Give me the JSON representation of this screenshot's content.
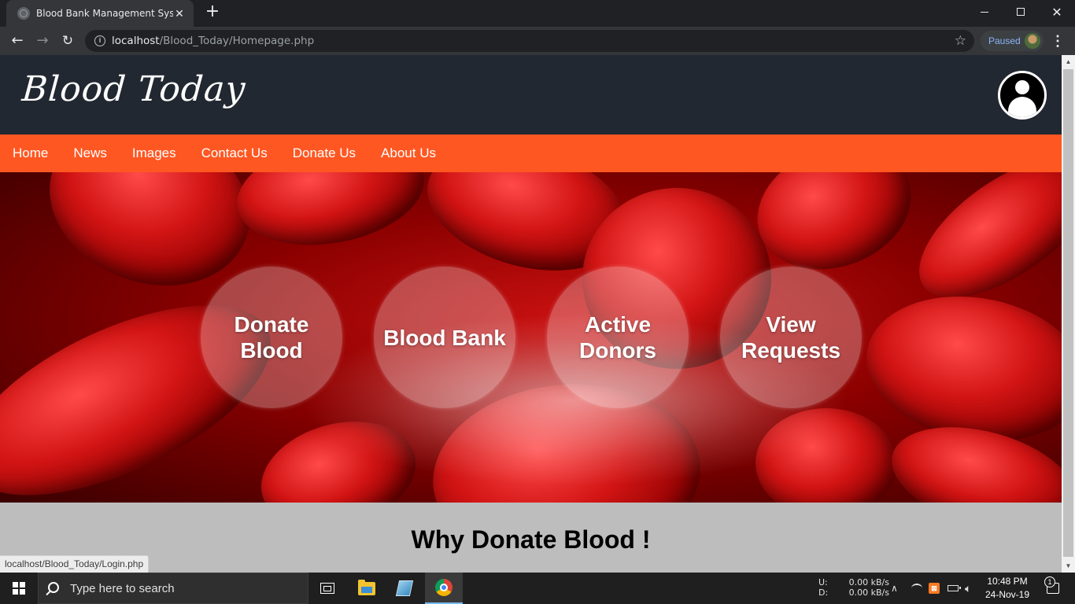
{
  "browser": {
    "tab_title": "Blood Bank Management System",
    "url_host": "localhost",
    "url_path": "/Blood_Today/Homepage.php",
    "profile_label": "Paused",
    "status_url": "localhost/Blood_Today/Login.php"
  },
  "site": {
    "logo": "Blood Today",
    "nav": [
      {
        "label": "Home"
      },
      {
        "label": "News"
      },
      {
        "label": "Images"
      },
      {
        "label": "Contact Us"
      },
      {
        "label": "Donate Us"
      },
      {
        "label": "About Us"
      }
    ],
    "bubbles": [
      {
        "label": "Donate Blood"
      },
      {
        "label": "Blood Bank"
      },
      {
        "label": "Active Donors"
      },
      {
        "label": "View Requests"
      }
    ],
    "section_title": "Why Donate Blood !"
  },
  "taskbar": {
    "search_placeholder": "Type here to search",
    "net_up_label": "U:",
    "net_up_value": "0.00 kB/s",
    "net_down_label": "D:",
    "net_down_value": "0.00 kB/s",
    "time": "10:48 PM",
    "date": "24-Nov-19",
    "notification_count": "1"
  },
  "colors": {
    "header_bg": "#222831",
    "nav_bg": "#ff5722",
    "page_bg": "#bdbdbd"
  }
}
